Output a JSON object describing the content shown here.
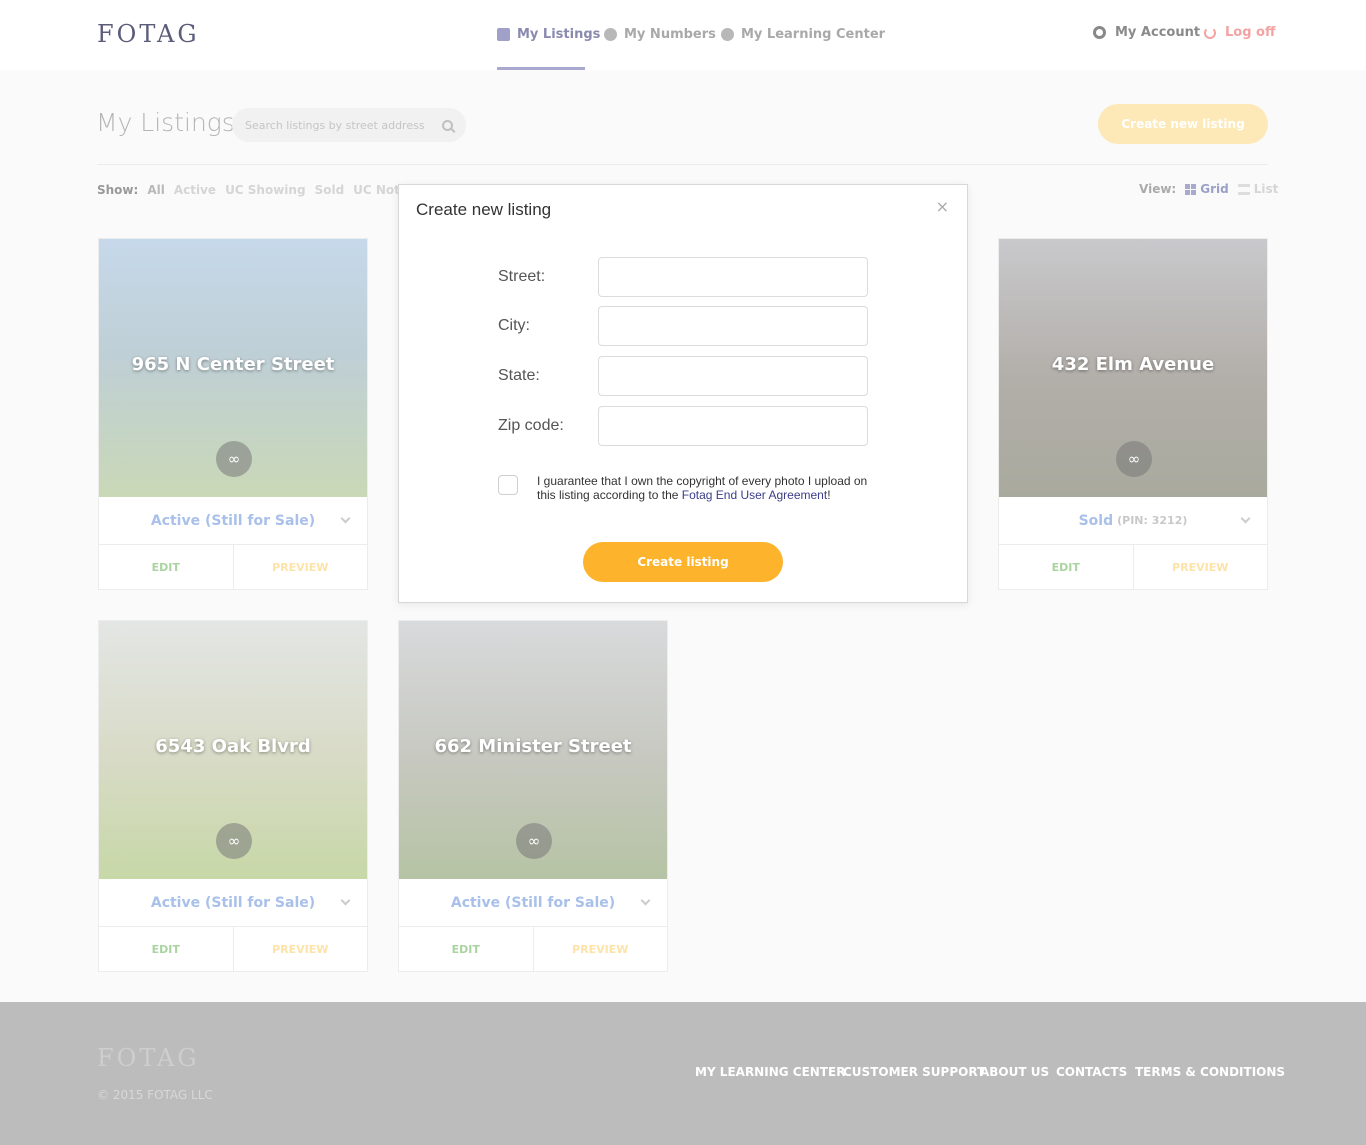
{
  "header": {
    "logo": "FOTAG",
    "nav": [
      {
        "label": "My Listings",
        "icon": "home-icon",
        "active": true
      },
      {
        "label": "My Numbers",
        "icon": "pie-chart-icon",
        "active": false
      },
      {
        "label": "My Learning Center",
        "icon": "question-icon",
        "active": false
      }
    ],
    "account_label": "My Account",
    "logoff_label": "Log off"
  },
  "toolbar": {
    "title": "My Listings",
    "search_placeholder": "Search listings by street address",
    "create_label": "Create new listing",
    "show_label": "Show:",
    "filters": [
      "All",
      "Active",
      "UC Showing",
      "Sold",
      "UC Not Show"
    ],
    "view_label": "View:",
    "view_grid": "Grid",
    "view_list": "List"
  },
  "listings": [
    {
      "address": "965 N Center Street",
      "status": "Active (Still for Sale)",
      "pin": "",
      "photo_color": "#b8cfe0"
    },
    {
      "address": "432 Elm Avenue",
      "status": "Sold",
      "pin": "(PIN: 3212)",
      "photo_color": "#b6b3b0"
    },
    {
      "address": "6543 Oak Blvrd",
      "status": "Active (Still for Sale)",
      "pin": "",
      "photo_color": "#d7dcc8"
    },
    {
      "address": "662 Minister Street",
      "status": "Active (Still for Sale)",
      "pin": "",
      "photo_color": "#c7cbc3"
    }
  ],
  "card_actions": {
    "edit": "EDIT",
    "preview": "PREVIEW"
  },
  "modal": {
    "title": "Create new listing",
    "close": "×",
    "fields": {
      "street": "Street:",
      "city": "City:",
      "state": "State:",
      "zip": "Zip code:"
    },
    "agree_text": "I guarantee that I own the copyright of every photo I upload on this listing according to the",
    "agree_link": "Fotag End User Agreement",
    "agree_end": "!",
    "submit": "Create listing"
  },
  "footer": {
    "logo": "FOTAG",
    "copyright": "© 2015 FOTAG LLC",
    "links": [
      "MY LEARNING CENTER",
      "CUSTOMER SUPPORT",
      "ABOUT US",
      "CONTACTS",
      "TERMS & CONDITIONS"
    ]
  }
}
